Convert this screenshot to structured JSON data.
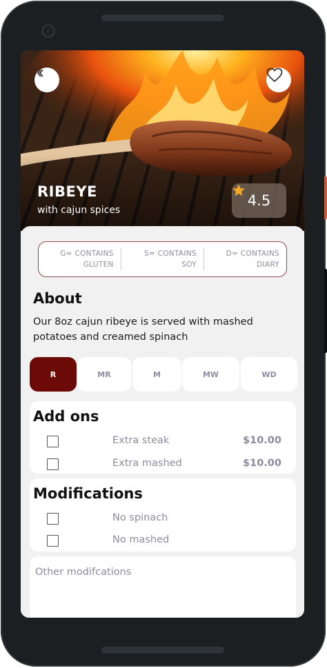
{
  "dish": {
    "title": "RIBEYE",
    "subtitle": "with cajun spices",
    "rating": "4.5"
  },
  "icons": {
    "back": "chevron-left-icon",
    "favorite": "heart-outline-icon",
    "rating": "star-icon"
  },
  "colors": {
    "accent": "#6b0a07",
    "star": "#f5a623",
    "muted_text": "#8e8aa0",
    "allergen_border": "#8a4a4a"
  },
  "allergens": [
    {
      "line1": "G= CONTAINS",
      "line2": "GLUTEN"
    },
    {
      "line1": "S= CONTAINS",
      "line2": "SOY"
    },
    {
      "line1": "D= CONTAINS",
      "line2": "DIARY"
    }
  ],
  "about": {
    "title": "About",
    "text": "Our 8oz cajun ribeye is served with mashed potatoes and creamed spinach"
  },
  "temperatures": {
    "selected": "R",
    "options": [
      "R",
      "MR",
      "M",
      "MW",
      "WD"
    ]
  },
  "addons": {
    "title": "Add ons",
    "items": [
      {
        "label": "Extra steak",
        "price": "$10.00",
        "checked": false
      },
      {
        "label": "Extra mashed",
        "price": "$10.00",
        "checked": false
      }
    ]
  },
  "modifications": {
    "title": "Modifications",
    "items": [
      {
        "label": "No spinach",
        "checked": false
      },
      {
        "label": "No mashed",
        "checked": false
      }
    ]
  },
  "other": {
    "placeholder": "Other modifcations"
  }
}
